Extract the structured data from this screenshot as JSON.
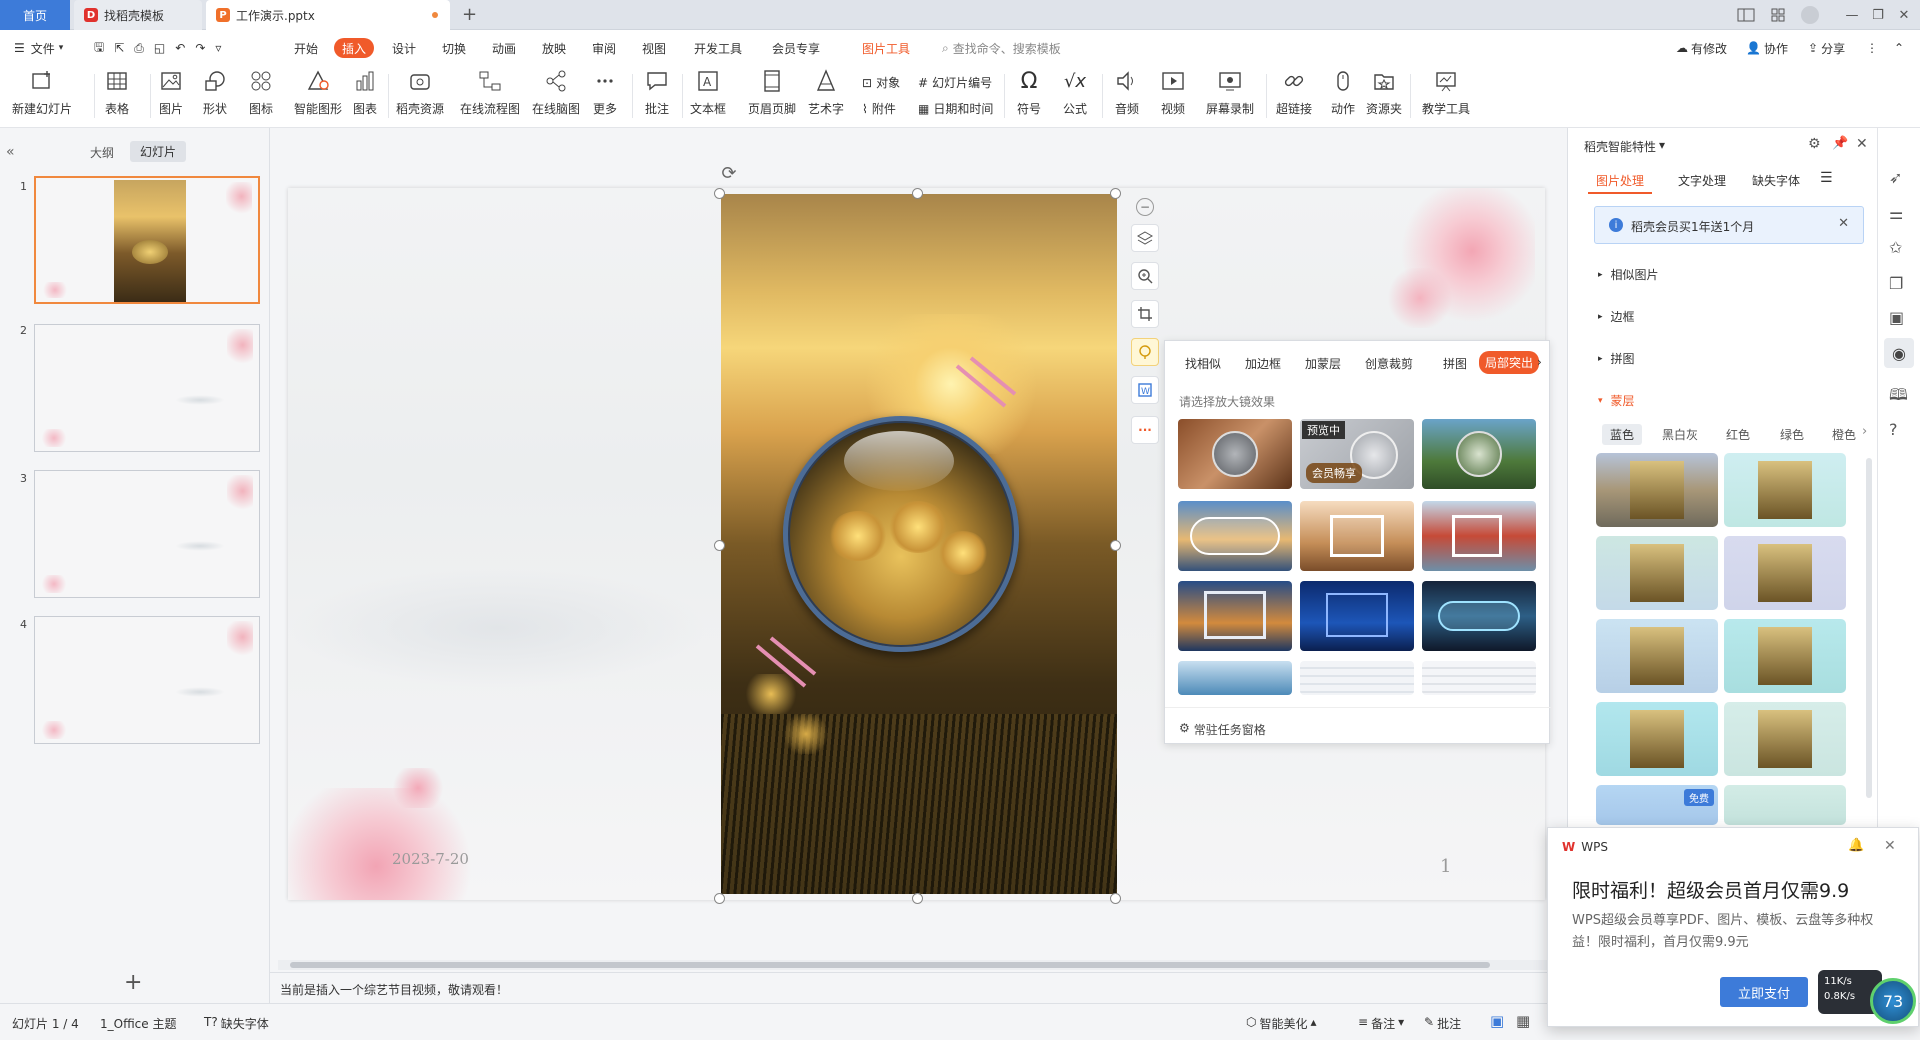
{
  "titlebar": {
    "tabs": [
      {
        "label": "首页"
      },
      {
        "label": "找稻壳模板"
      },
      {
        "label": "工作演示.pptx"
      }
    ],
    "new_tab": "+"
  },
  "menu": {
    "file": "文件",
    "items": [
      "开始",
      "插入",
      "设计",
      "切换",
      "动画",
      "放映",
      "审阅",
      "视图",
      "开发工具",
      "会员专享",
      "图片工具"
    ],
    "active": "插入",
    "search_placeholder": "查找命令、搜索模板",
    "right": [
      "有修改",
      "协作",
      "分享"
    ]
  },
  "ribbon": {
    "buttons": [
      {
        "label": "新建幻灯片",
        "icon": "new-slide-icon"
      },
      {
        "label": "表格",
        "icon": "table-icon"
      },
      {
        "label": "图片",
        "icon": "picture-icon"
      },
      {
        "label": "形状",
        "icon": "shape-icon"
      },
      {
        "label": "图标",
        "icon": "icons-icon"
      },
      {
        "label": "智能图形",
        "icon": "smartart-icon"
      },
      {
        "label": "图表",
        "icon": "chart-icon"
      },
      {
        "label": "稻壳资源",
        "icon": "resource-icon"
      },
      {
        "label": "在线流程图",
        "icon": "flowchart-icon"
      },
      {
        "label": "在线脑图",
        "icon": "mindmap-icon"
      },
      {
        "label": "更多",
        "icon": "more-icon"
      },
      {
        "label": "批注",
        "icon": "comment-icon"
      },
      {
        "label": "文本框",
        "icon": "textbox-icon"
      },
      {
        "label": "页眉页脚",
        "icon": "header-footer-icon"
      },
      {
        "label": "艺术字",
        "icon": "wordart-icon"
      },
      {
        "label": "符号",
        "icon": "symbol-icon"
      },
      {
        "label": "公式",
        "icon": "formula-icon"
      },
      {
        "label": "音频",
        "icon": "audio-icon"
      },
      {
        "label": "视频",
        "icon": "video-icon"
      },
      {
        "label": "屏幕录制",
        "icon": "screen-record-icon"
      },
      {
        "label": "超链接",
        "icon": "hyperlink-icon"
      },
      {
        "label": "动作",
        "icon": "action-icon"
      },
      {
        "label": "资源夹",
        "icon": "folder-icon"
      },
      {
        "label": "教学工具",
        "icon": "teaching-icon"
      }
    ],
    "small": [
      "对象",
      "幻灯片编号",
      "附件",
      "日期和时间"
    ]
  },
  "left_panel": {
    "tabs": [
      "大纲",
      "幻灯片"
    ],
    "slides": [
      "1",
      "2",
      "3",
      "4"
    ],
    "add": "+"
  },
  "slide": {
    "date": "2023-7-20",
    "page_number": "1"
  },
  "popup": {
    "tabs": [
      "找相似",
      "加边框",
      "加蒙层",
      "创意裁剪",
      "拼图",
      "局部突出"
    ],
    "hint": "请选择放大镜效果",
    "preview_badge": "预览中",
    "member_badge": "会员畅享",
    "footer": "常驻任务窗格"
  },
  "right_panel": {
    "title": "稻壳智能特性",
    "tabs": [
      "图片处理",
      "文字处理",
      "缺失字体"
    ],
    "banner": "稻壳会员买1年送1个月",
    "sections": [
      "相似图片",
      "边框",
      "拼图",
      "蒙层"
    ],
    "color_tabs": [
      "蓝色",
      "黑白灰",
      "红色",
      "绿色",
      "橙色"
    ],
    "free_badge": "免费"
  },
  "notes_text": "当前是插入一个综艺节目视频，敬请观看！",
  "status": {
    "slide_info": "幻灯片 1 / 4",
    "theme": "1_Office 主题",
    "missing_font": "缺失字体",
    "beautify": "智能美化",
    "notes": "备注",
    "comments": "批注"
  },
  "notification": {
    "brand": "WPS",
    "title": "限时福利！超级会员首月仅需9.9",
    "body": "WPS超级会员尊享PDF、图片、模板、云盘等多种权益！限时福利，首月仅需9.9元",
    "button": "立即支付",
    "speed_up": "11K/s",
    "speed_down": "0.8K/s",
    "percent": "73"
  }
}
